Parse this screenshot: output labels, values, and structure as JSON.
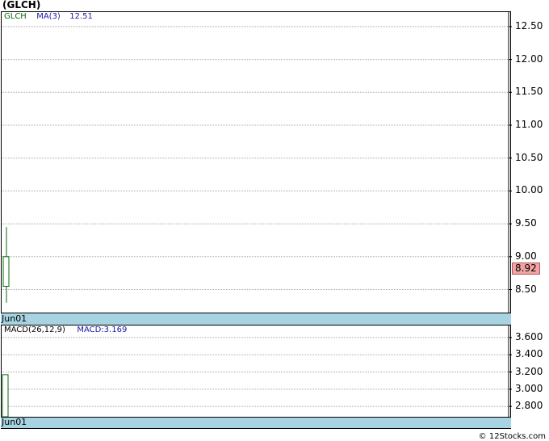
{
  "title": "(GLCH)",
  "price_panel": {
    "legend_symbol": "GLCH",
    "legend_ma_label": "MA(3)",
    "legend_ma_value": "12.51",
    "yticks": [
      "12.50",
      "12.00",
      "11.50",
      "11.00",
      "10.50",
      "10.00",
      "9.50",
      "9.00",
      "8.50"
    ],
    "ylim": [
      8.15,
      12.72
    ],
    "last_price": "8.92",
    "date_label": "Jun01"
  },
  "macd_panel": {
    "legend_label": "MACD(26,12,9)",
    "legend_value": "MACD:3.169",
    "yticks": [
      "3.600",
      "3.400",
      "3.200",
      "3.000",
      "2.800"
    ],
    "ylim": [
      2.68,
      3.74
    ],
    "date_label": "Jun01"
  },
  "chart_data": [
    {
      "type": "candlestick",
      "x": [
        "Jun01"
      ],
      "open": [
        8.55
      ],
      "close": [
        9.0
      ],
      "high": [
        9.45
      ],
      "low": [
        8.3
      ],
      "ma3": [
        12.51
      ],
      "ylim": [
        8.15,
        12.72
      ],
      "grid": true
    },
    {
      "type": "bar",
      "x": [
        "Jun01"
      ],
      "values": [
        3.169
      ],
      "ylim": [
        2.68,
        3.74
      ],
      "grid": true
    }
  ],
  "colors": {
    "up_candle": "#0a6a0a",
    "grid": "#a8a8a8",
    "ma_legend": "#1a1aa8",
    "symbol_legend": "#0a6a0a",
    "date_strip": "#a7d3e3",
    "price_badge": "#f2a3a3"
  },
  "watermark": "© 12Stocks.com"
}
